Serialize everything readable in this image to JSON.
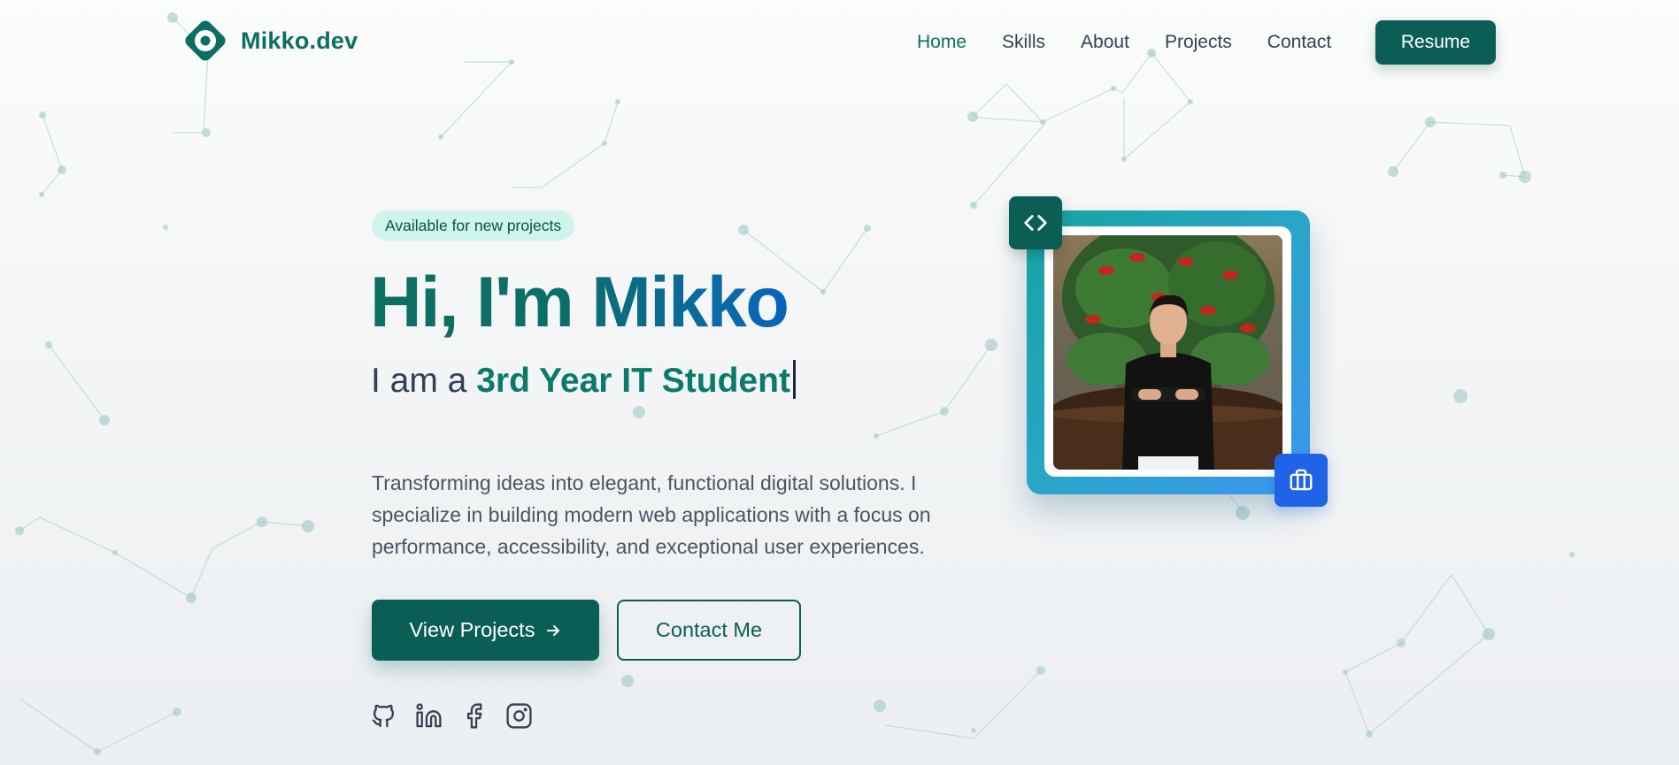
{
  "brand": {
    "name": "Mikko.dev"
  },
  "nav": {
    "items": [
      {
        "label": "Home",
        "active": true
      },
      {
        "label": "Skills"
      },
      {
        "label": "About"
      },
      {
        "label": "Projects"
      },
      {
        "label": "Contact"
      }
    ],
    "resume_label": "Resume"
  },
  "hero": {
    "badge": "Available for new projects",
    "greeting": "Hi, I'm Mikko",
    "subline_prefix": "I am a ",
    "role": "3rd Year IT Student",
    "description": "Transforming ideas into elegant, functional digital solutions. I specialize in building modern web applications with a focus on performance, accessibility, and exceptional user experiences.",
    "primary_cta": "View Projects",
    "secondary_cta": "Contact Me",
    "socials": [
      {
        "icon": "github-icon"
      },
      {
        "icon": "linkedin-icon"
      },
      {
        "icon": "facebook-icon"
      },
      {
        "icon": "instagram-icon"
      }
    ]
  },
  "portrait": {
    "top_badge_icon": "code-icon",
    "bottom_badge_icon": "briefcase-icon"
  },
  "colors": {
    "primary": "#0b5e55",
    "accent_text": "#0c7a6a",
    "gradient_blue": "#0a62bd",
    "badge_bg": "#cdf5ec",
    "briefcase_badge": "#1f63e6"
  }
}
